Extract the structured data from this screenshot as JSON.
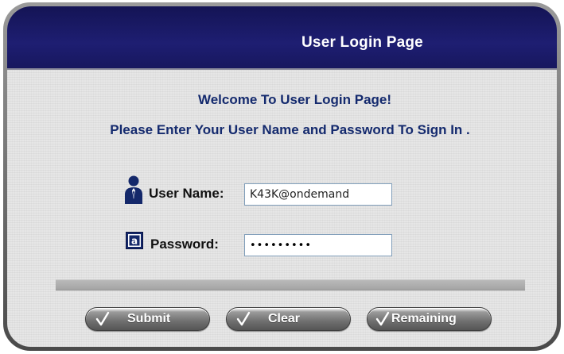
{
  "header": {
    "title": "User Login Page"
  },
  "welcome": {
    "line1": "Welcome To User Login Page!",
    "line2": "Please Enter Your User Name and Password To Sign In ."
  },
  "form": {
    "username": {
      "label": "User Name:",
      "value": "K43K@ondemand",
      "icon": "user-icon"
    },
    "password": {
      "label": "Password:",
      "value": "•••••••••",
      "icon": "password-icon"
    }
  },
  "buttons": {
    "submit": "Submit",
    "clear": "Clear",
    "remaining": "Remaining"
  },
  "colors": {
    "header": "#1e1e72",
    "heading_text": "#142a6e",
    "button": "#6f6f6f"
  }
}
